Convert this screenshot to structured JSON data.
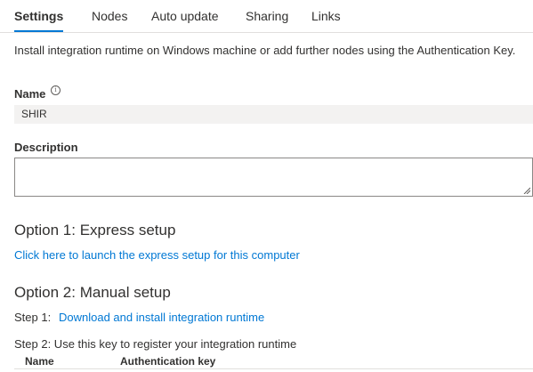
{
  "tabs": [
    {
      "label": "Settings",
      "active": true
    },
    {
      "label": "Nodes",
      "active": false
    },
    {
      "label": "Auto update",
      "active": false
    },
    {
      "label": "Sharing",
      "active": false
    },
    {
      "label": "Links",
      "active": false
    }
  ],
  "intro": "Install integration runtime on Windows machine or add further nodes using the Authentication Key.",
  "name": {
    "label": "Name",
    "info_icon": "info-icon",
    "value": "SHIR"
  },
  "description": {
    "label": "Description",
    "value": ""
  },
  "option1": {
    "heading": "Option 1: Express setup",
    "link": "Click here to launch the express setup for this computer"
  },
  "option2": {
    "heading": "Option 2: Manual setup",
    "step1_prefix": "Step 1:",
    "step1_link": "Download and install integration runtime",
    "step2": "Step 2: Use this key to register your integration runtime"
  },
  "keys_table": {
    "columns": [
      "Name",
      "Authentication key"
    ]
  },
  "colors": {
    "accent": "#0078d4",
    "text": "#323130",
    "field_bg": "#f3f2f1",
    "border": "#8a8886"
  }
}
